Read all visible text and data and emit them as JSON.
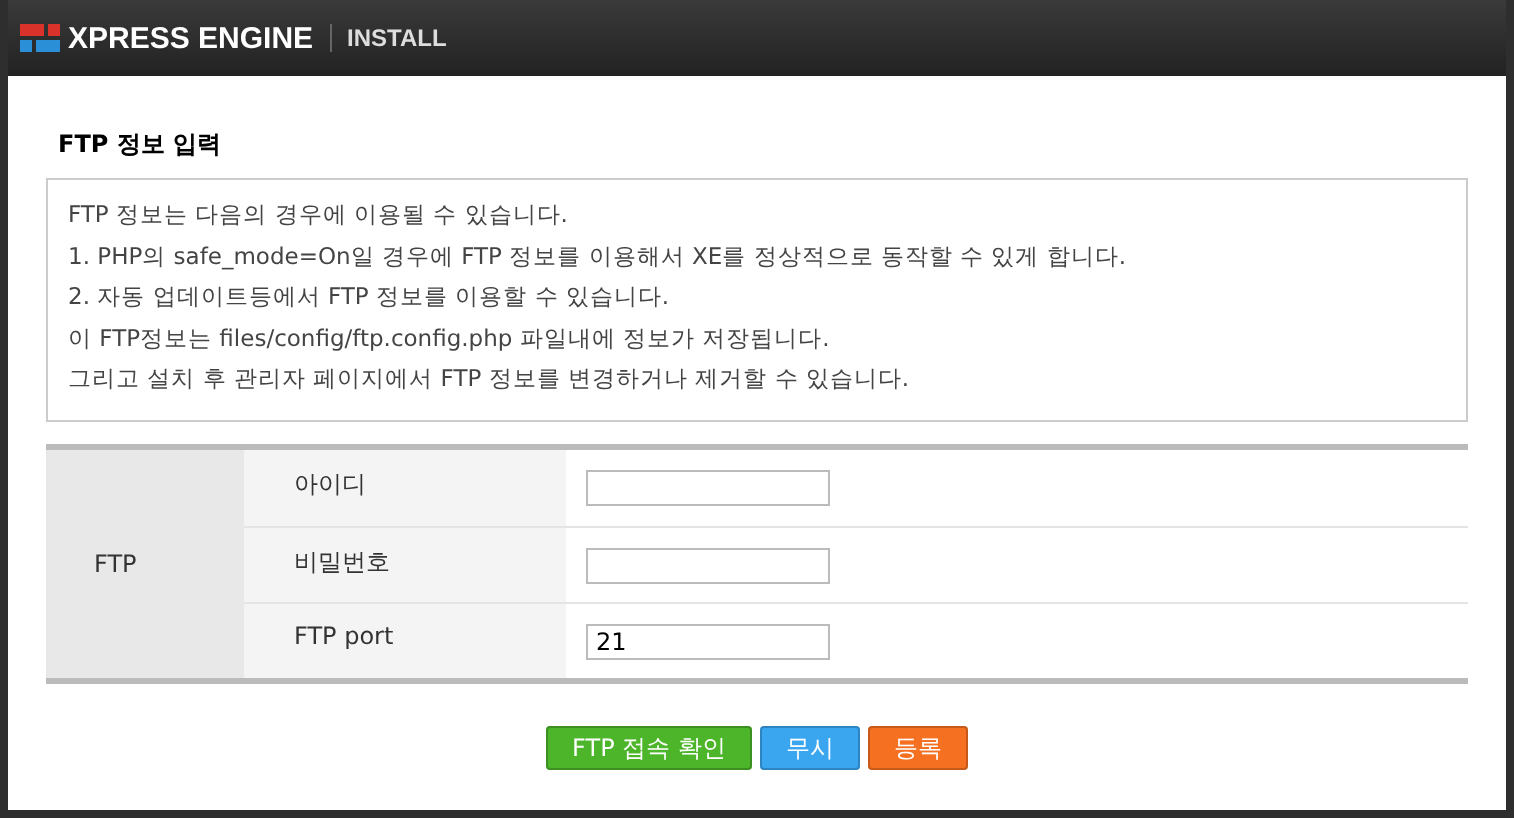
{
  "header": {
    "logo": "XPRESS ENGINE",
    "subtitle": "INSTALL"
  },
  "section_title": "FTP 정보 입력",
  "info_lines": [
    "FTP 정보는 다음의 경우에 이용될 수 있습니다.",
    "1. PHP의 safe_mode=On일 경우에 FTP 정보를 이용해서 XE를 정상적으로 동작할 수 있게 합니다.",
    "2. 자동 업데이트등에서 FTP 정보를 이용할 수 있습니다.",
    "이 FTP정보는 files/config/ftp.config.php 파일내에 정보가 저장됩니다.",
    "그리고 설치 후 관리자 페이지에서 FTP 정보를 변경하거나 제거할 수 있습니다."
  ],
  "form": {
    "group": "FTP",
    "fields": [
      {
        "label": "아이디"
      },
      {
        "label": "비밀번호"
      },
      {
        "label": "FTP port",
        "value": "21"
      }
    ]
  },
  "buttons": [
    {
      "label": "FTP 접속 확인",
      "kind": "green"
    },
    {
      "label": "무시",
      "kind": "blue"
    },
    {
      "label": "등록",
      "kind": "orange"
    }
  ]
}
